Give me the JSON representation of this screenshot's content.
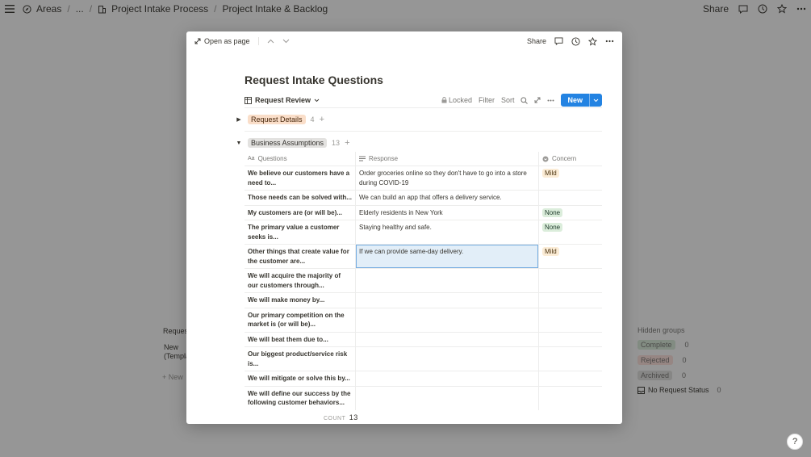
{
  "topbar": {
    "breadcrumb": [
      "Areas",
      "...",
      "Project Intake Process",
      "Project Intake & Backlog"
    ],
    "share_label": "Share"
  },
  "background": {
    "card_group_label": "Request",
    "card_title": "New (Templa",
    "new_label": "+ New",
    "hidden_groups": {
      "title": "Hidden groups",
      "items": [
        {
          "label": "Complete",
          "count": "0",
          "color": "#dbeddb"
        },
        {
          "label": "Rejected",
          "count": "0",
          "color": "#ffe2dd"
        },
        {
          "label": "Archived",
          "count": "0",
          "color": "#e3e2e0"
        },
        {
          "label": "No Request Status",
          "count": "0",
          "color": "transparent"
        }
      ]
    },
    "help": "?"
  },
  "modal": {
    "open_as_page": "Open as page",
    "share_label": "Share",
    "title": "Request Intake Questions",
    "view_name": "Request Review",
    "locked_label": "Locked",
    "filter_label": "Filter",
    "sort_label": "Sort",
    "new_label": "New",
    "groups": [
      {
        "label": "Request Details",
        "count": "4",
        "color": "#fadec9",
        "collapsed": true
      },
      {
        "label": "Business Assumptions",
        "count": "13",
        "color": "#e3e2e0",
        "collapsed": false
      }
    ],
    "columns": [
      "Questions",
      "Response",
      "Concern"
    ],
    "rows": [
      {
        "q": "We believe our customers have a need to...",
        "r": "Order groceries online so they don't have to go into a store during COVID-19",
        "c": "Mild"
      },
      {
        "q": "Those needs can be solved with...",
        "r": "We can build an app that offers a delivery service.",
        "c": ""
      },
      {
        "q": "My customers are (or will be)...",
        "r": "Elderly residents in New York",
        "c": "None"
      },
      {
        "q": "The primary value a customer seeks is...",
        "r": "Staying healthy and safe.",
        "c": "None"
      },
      {
        "q": "Other things that create value for the customer are...",
        "r": "If we can provide same-day delivery.",
        "c": "Mild"
      },
      {
        "q": "We will acquire the majority of our customers through...",
        "r": "",
        "c": ""
      },
      {
        "q": "We will make money by...",
        "r": "",
        "c": ""
      },
      {
        "q": "Our primary competition on the market is (or will be)...",
        "r": "",
        "c": ""
      },
      {
        "q": "We will beat them due to...",
        "r": "",
        "c": ""
      },
      {
        "q": "Our biggest product/service risk is...",
        "r": "",
        "c": ""
      },
      {
        "q": "We will mitigate or solve this by...",
        "r": "",
        "c": ""
      },
      {
        "q": "We will define our success by the following customer behaviors...",
        "r": "",
        "c": ""
      }
    ],
    "count_label": "COUNT",
    "count_value": "13"
  }
}
